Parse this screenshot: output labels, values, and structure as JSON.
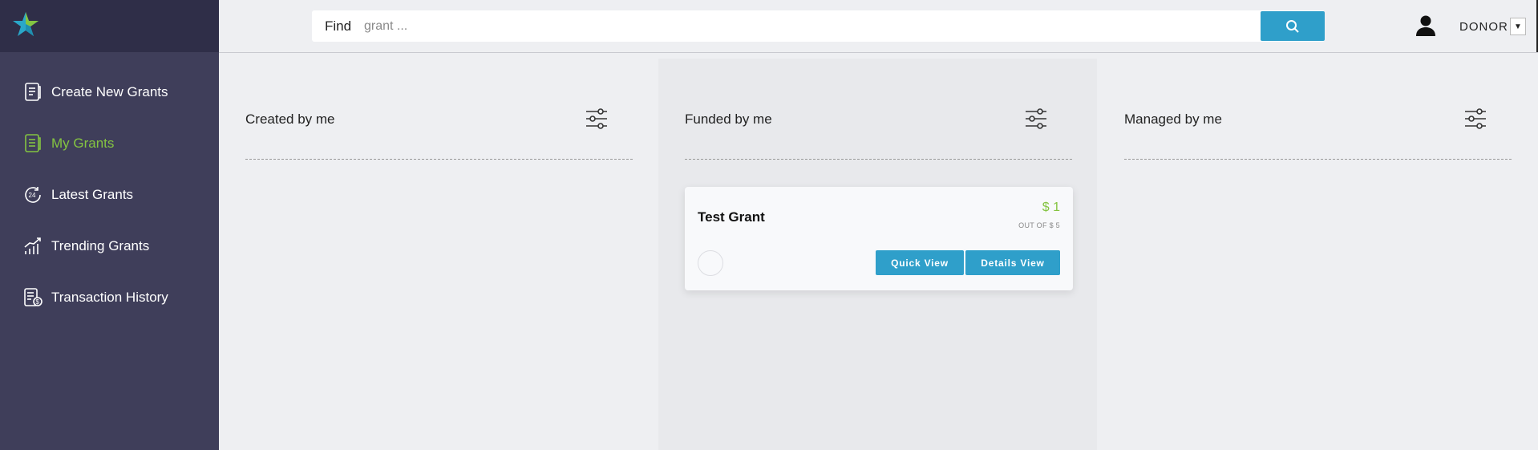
{
  "sidebar": {
    "items": [
      {
        "label": "Create New Grants",
        "icon": "receipt-icon"
      },
      {
        "label": "My Grants",
        "icon": "list-icon",
        "active": true
      },
      {
        "label": "Latest Grants",
        "icon": "clock-24-icon"
      },
      {
        "label": "Trending Grants",
        "icon": "trending-chart-icon"
      },
      {
        "label": "Transaction History",
        "icon": "transaction-icon"
      }
    ]
  },
  "header": {
    "find_label": "Find",
    "search_placeholder": "grant ...",
    "search_value": "",
    "user_role": "DONOR"
  },
  "columns": [
    {
      "title": "Created by me"
    },
    {
      "title": "Funded by me"
    },
    {
      "title": "Managed by me"
    }
  ],
  "grant_card": {
    "title": "Test Grant",
    "amount": "$ 1",
    "out_of": "OUT OF $ 5",
    "quick_view_label": "Quick View",
    "details_view_label": "Details View"
  },
  "colors": {
    "sidebar_bg": "#3f3e5a",
    "accent_green": "#84c441",
    "accent_blue": "#2f9fca"
  }
}
